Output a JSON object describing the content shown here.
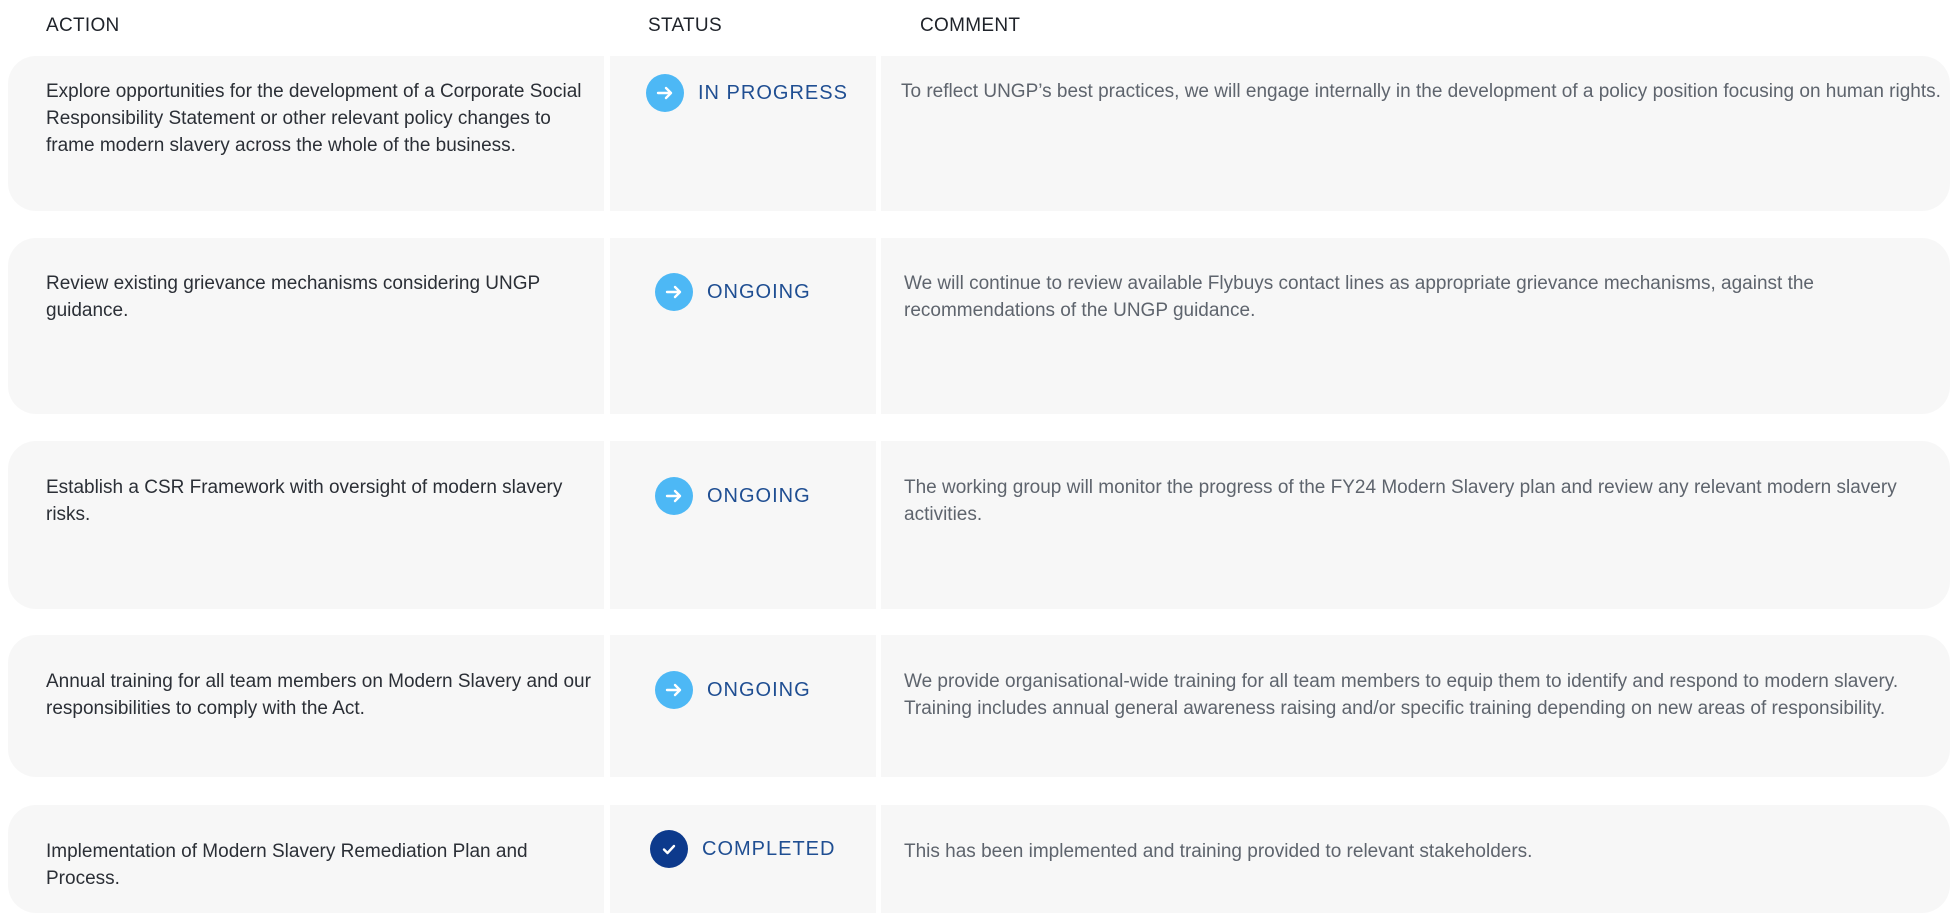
{
  "header": {
    "action": "ACTION",
    "status": "STATUS",
    "comment": "COMMENT"
  },
  "colors": {
    "row_bg": "#f7f7f7",
    "arrow_icon": "#4db8f5",
    "check_icon": "#0d3a8c",
    "status_text": "#1f4e92"
  },
  "rows": [
    {
      "action": "Explore opportunities for the development of a Corporate Social Responsibility Statement or other relevant policy changes to frame modern slavery across the whole of the business.",
      "status": "IN PROGRESS",
      "status_icon": "arrow-right-icon",
      "comment": "To reflect UNGP’s best practices, we will engage internally in the development of a policy position focusing on human rights."
    },
    {
      "action": "Review existing grievance mechanisms considering UNGP guidance.",
      "status": "ONGOING",
      "status_icon": "arrow-right-icon",
      "comment": "We will continue to review available Flybuys contact lines as appropriate grievance mechanisms, against the recommendations of the UNGP guidance."
    },
    {
      "action": "Establish a CSR Framework with oversight of modern slavery risks.",
      "status": "ONGOING",
      "status_icon": "arrow-right-icon",
      "comment": "The working group will monitor the progress of the FY24 Modern Slavery plan and review any relevant modern slavery activities."
    },
    {
      "action": "Annual training for all team members on Modern Slavery and our responsibilities to comply with the Act.",
      "status": "ONGOING",
      "status_icon": "arrow-right-icon",
      "comment": "We provide organisational-wide training for all team members to equip them to identify and respond to modern slavery. Training includes annual general awareness raising and/or specific training depending on new areas of responsibility."
    },
    {
      "action": "Implementation of Modern Slavery Remediation Plan and Process.",
      "status": "COMPLETED",
      "status_icon": "check-icon",
      "comment": "This has been implemented and training provided to relevant stakeholders."
    }
  ]
}
